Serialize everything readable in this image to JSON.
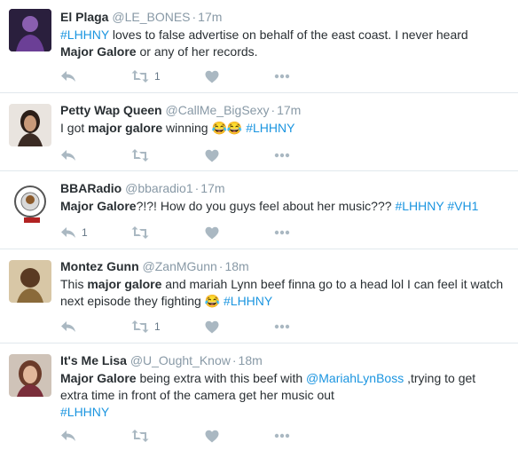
{
  "tweets": [
    {
      "name": "El Plaga",
      "handle": "@LE_BONES",
      "time": "17m",
      "body": [
        {
          "t": "#LHHNY",
          "type": "tag"
        },
        {
          "t": " loves to false advertise on behalf of the east coast. I never heard ",
          "type": "text"
        },
        {
          "t": "Major Galore",
          "type": "kw"
        },
        {
          "t": " or any of her records.",
          "type": "text"
        }
      ],
      "reply_count": "",
      "retweet_count": "1",
      "like_count": ""
    },
    {
      "name": "Petty Wap Queen",
      "handle": "@CallMe_BigSexy",
      "time": "17m",
      "body": [
        {
          "t": "I got ",
          "type": "text"
        },
        {
          "t": "major galore",
          "type": "kw"
        },
        {
          "t": " winning ",
          "type": "text"
        },
        {
          "t": "😂😂",
          "type": "emoji"
        },
        {
          "t": " ",
          "type": "text"
        },
        {
          "t": "#LHHNY",
          "type": "tag"
        }
      ],
      "reply_count": "",
      "retweet_count": "",
      "like_count": ""
    },
    {
      "name": "BBARadio",
      "handle": "@bbaradio1",
      "time": "17m",
      "body": [
        {
          "t": "Major Galore",
          "type": "kw"
        },
        {
          "t": "?!?! How do you guys feel about her music??? ",
          "type": "text"
        },
        {
          "t": "#LHHNY",
          "type": "tag"
        },
        {
          "t": " ",
          "type": "text"
        },
        {
          "t": "#VH1",
          "type": "tag"
        }
      ],
      "reply_count": "1",
      "retweet_count": "",
      "like_count": ""
    },
    {
      "name": "Montez Gunn",
      "handle": "@ZanMGunn",
      "time": "18m",
      "body": [
        {
          "t": "This ",
          "type": "text"
        },
        {
          "t": "major galore",
          "type": "kw"
        },
        {
          "t": " and mariah Lynn beef finna go to a head lol I can feel it watch next episode they fighting ",
          "type": "text"
        },
        {
          "t": "😂",
          "type": "emoji"
        },
        {
          "t": " ",
          "type": "text"
        },
        {
          "t": "#LHHNY",
          "type": "tag"
        }
      ],
      "reply_count": "",
      "retweet_count": "1",
      "like_count": ""
    },
    {
      "name": "It's Me Lisa",
      "handle": "@U_Ought_Know",
      "time": "18m",
      "body": [
        {
          "t": "Major Galore",
          "type": "kw"
        },
        {
          "t": " being extra with this beef with ",
          "type": "text"
        },
        {
          "t": "@MariahLynBoss",
          "type": "tag"
        },
        {
          "t": " ,trying to get extra time in front of the camera get her music out",
          "type": "text"
        },
        {
          "t": "\n",
          "type": "br"
        },
        {
          "t": "#LHHNY",
          "type": "tag"
        }
      ],
      "reply_count": "",
      "retweet_count": "",
      "like_count": ""
    }
  ],
  "avatar_icon": "user-avatar",
  "colors": {
    "name": "#292f33",
    "meta": "#8899a6",
    "link": "#1b95e0",
    "icon": "#aab8c2",
    "divider": "#e1e8ed"
  }
}
